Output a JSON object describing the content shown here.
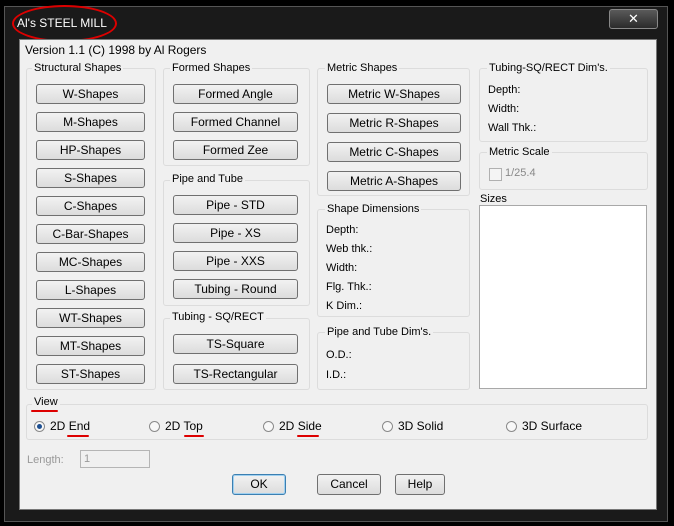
{
  "window": {
    "title": "Al's STEEL MILL",
    "close_icon": "✕"
  },
  "version": "Version 1.1 (C) 1998 by Al Rogers",
  "structural": {
    "label": "Structural Shapes",
    "buttons": [
      "W-Shapes",
      "M-Shapes",
      "HP-Shapes",
      "S-Shapes",
      "C-Shapes",
      "C-Bar-Shapes",
      "MC-Shapes",
      "L-Shapes",
      "WT-Shapes",
      "MT-Shapes",
      "ST-Shapes"
    ]
  },
  "formed": {
    "label": "Formed Shapes",
    "buttons": [
      "Formed Angle",
      "Formed Channel",
      "Formed Zee"
    ]
  },
  "pipe": {
    "label": "Pipe and Tube",
    "buttons": [
      "Pipe - STD",
      "Pipe - XS",
      "Pipe - XXS",
      "Tubing - Round"
    ]
  },
  "tubing_sq": {
    "label": "Tubing - SQ/RECT",
    "buttons": [
      "TS-Square",
      "TS-Rectangular"
    ]
  },
  "metric": {
    "label": "Metric Shapes",
    "buttons": [
      "Metric W-Shapes",
      "Metric R-Shapes",
      "Metric C-Shapes",
      "Metric A-Shapes"
    ]
  },
  "shape_dims": {
    "label": "Shape Dimensions",
    "fields": [
      "Depth:",
      "Web thk.:",
      "Width:",
      "Flg. Thk.:",
      "K Dim.:"
    ]
  },
  "pipe_dims": {
    "label": "Pipe and Tube Dim's.",
    "fields": [
      "O.D.:",
      "I.D.:"
    ]
  },
  "tube_dims": {
    "label": "Tubing-SQ/RECT Dim's.",
    "fields": [
      "Depth:",
      "Width:",
      "Wall Thk.:"
    ]
  },
  "metric_scale": {
    "label": "Metric Scale",
    "checkbox": "1/25.4",
    "checked": false
  },
  "sizes": {
    "label": "Sizes"
  },
  "view": {
    "label": "View",
    "options": [
      {
        "pre": "2D ",
        "post": "End",
        "selected": true
      },
      {
        "pre": "2D ",
        "post": "Top",
        "selected": false
      },
      {
        "pre": "2D ",
        "post": "Side",
        "selected": false
      },
      {
        "pre": "",
        "post": "3D Solid",
        "selected": false
      },
      {
        "pre": "",
        "post": "3D Surface",
        "selected": false
      }
    ]
  },
  "length": {
    "label": "Length:",
    "value": "1"
  },
  "actions": {
    "ok": "OK",
    "cancel": "Cancel",
    "help": "Help"
  },
  "annotation_color": "#d00"
}
